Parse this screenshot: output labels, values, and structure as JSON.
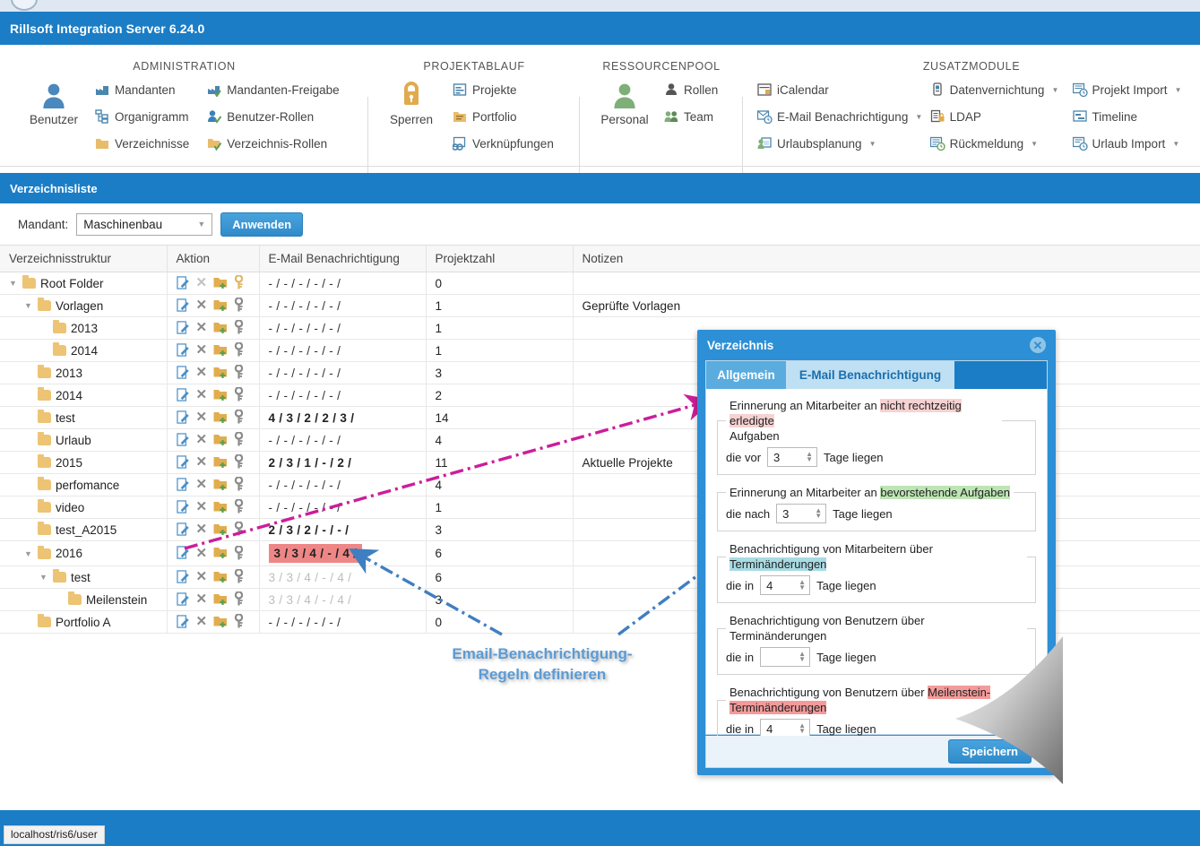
{
  "app": {
    "title": "Rillsoft Integration Server 6.24.0"
  },
  "ribbon": {
    "groups": [
      {
        "title": "ADMINISTRATION",
        "big": {
          "label": "Benutzer",
          "icon": "user-icon"
        },
        "items": [
          {
            "label": "Mandanten",
            "icon": "factory-icon",
            "caret": false
          },
          {
            "label": "Organigramm",
            "icon": "orgchart-icon",
            "caret": false
          },
          {
            "label": "Verzeichnisse",
            "icon": "folder-icon",
            "caret": false
          },
          {
            "label": "Mandanten-Freigabe",
            "icon": "factory-check-icon",
            "caret": false
          },
          {
            "label": "Benutzer-Rollen",
            "icon": "user-check-icon",
            "caret": false
          },
          {
            "label": "Verzeichnis-Rollen",
            "icon": "folder-check-icon",
            "caret": false
          }
        ]
      },
      {
        "title": "PROJEKTABLAUF",
        "big": {
          "label": "Sperren",
          "icon": "lock-icon"
        },
        "items": [
          {
            "label": "Projekte",
            "icon": "project-icon",
            "caret": false
          },
          {
            "label": "Portfolio",
            "icon": "portfolio-icon",
            "caret": false
          },
          {
            "label": "Verknüpfungen",
            "icon": "link-icon",
            "caret": false
          }
        ]
      },
      {
        "title": "RESSOURCENPOOL",
        "big": {
          "label": "Personal",
          "icon": "staff-icon"
        },
        "items": [
          {
            "label": "Rollen",
            "icon": "role-icon",
            "caret": false
          },
          {
            "label": "Team",
            "icon": "team-icon",
            "caret": false
          }
        ]
      },
      {
        "title": "ZUSATZMODULE",
        "items": [
          {
            "label": "iCalendar",
            "icon": "calendar-icon",
            "caret": false
          },
          {
            "label": "E-Mail Benachrichtigung",
            "icon": "mail-clock-icon",
            "caret": true
          },
          {
            "label": "Urlaubsplanung",
            "icon": "vacation-icon",
            "caret": true
          },
          {
            "label": "Datenvernichtung",
            "icon": "shredder-icon",
            "caret": true
          },
          {
            "label": "LDAP",
            "icon": "ldap-icon",
            "caret": false
          },
          {
            "label": "Rückmeldung",
            "icon": "feedback-icon",
            "caret": true
          },
          {
            "label": "Projekt Import",
            "icon": "project-import-icon",
            "caret": true
          },
          {
            "label": "Timeline",
            "icon": "timeline-icon",
            "caret": false
          },
          {
            "label": "Urlaub Import",
            "icon": "vacation-import-icon",
            "caret": true
          }
        ]
      }
    ]
  },
  "section": {
    "title": "Verzeichnisliste"
  },
  "filter": {
    "label": "Mandant:",
    "selected": "Maschinenbau",
    "apply_label": "Anwenden"
  },
  "table": {
    "headers": [
      "Verzeichnisstruktur",
      "Aktion",
      "E-Mail Benachrichtigung",
      "Projektzahl",
      "Notizen"
    ],
    "rows": [
      {
        "name": "Root Folder",
        "indent": 0,
        "expander": "open",
        "email": "- / - / - / - / - /",
        "style": "none",
        "projects": "0",
        "notes": "",
        "delete_dim": true,
        "key_gold": true
      },
      {
        "name": "Vorlagen",
        "indent": 1,
        "expander": "open",
        "email": "- / - / - / - / - /",
        "style": "none",
        "projects": "1",
        "notes": "Geprüfte Vorlagen",
        "delete_dim": false,
        "key_gold": false
      },
      {
        "name": "2013",
        "indent": 2,
        "expander": "none",
        "email": "- / - / - / - / - /",
        "style": "none",
        "projects": "1",
        "notes": "",
        "delete_dim": false,
        "key_gold": false
      },
      {
        "name": "2014",
        "indent": 2,
        "expander": "none",
        "email": "- / - / - / - / - /",
        "style": "none",
        "projects": "1",
        "notes": "",
        "delete_dim": false,
        "key_gold": false
      },
      {
        "name": "2013",
        "indent": 1,
        "expander": "none",
        "email": "- / - / - / - / - /",
        "style": "none",
        "projects": "3",
        "notes": "",
        "delete_dim": false,
        "key_gold": false
      },
      {
        "name": "2014",
        "indent": 1,
        "expander": "none",
        "email": "- / - / - / - / - /",
        "style": "none",
        "projects": "2",
        "notes": "",
        "delete_dim": false,
        "key_gold": false
      },
      {
        "name": "test",
        "indent": 1,
        "expander": "none",
        "email": "4 / 3 / 2 / 2 / 3 /",
        "style": "bold",
        "projects": "14",
        "notes": "",
        "delete_dim": false,
        "key_gold": false
      },
      {
        "name": "Urlaub",
        "indent": 1,
        "expander": "none",
        "email": "- / - / - / - / - /",
        "style": "none",
        "projects": "4",
        "notes": "",
        "delete_dim": false,
        "key_gold": false
      },
      {
        "name": "2015",
        "indent": 1,
        "expander": "none",
        "email": "2 / 3 / 1 / - / 2 /",
        "style": "bold",
        "projects": "11",
        "notes": "Aktuelle Projekte",
        "delete_dim": false,
        "key_gold": false
      },
      {
        "name": "perfomance",
        "indent": 1,
        "expander": "none",
        "email": "- / - / - / - / - /",
        "style": "none",
        "projects": "4",
        "notes": "",
        "delete_dim": false,
        "key_gold": false
      },
      {
        "name": "video",
        "indent": 1,
        "expander": "none",
        "email": "- / - / - / - / - /",
        "style": "none",
        "projects": "1",
        "notes": "",
        "delete_dim": false,
        "key_gold": false
      },
      {
        "name": "test_A2015",
        "indent": 1,
        "expander": "none",
        "email": "2 / 3 / 2 / - / - /",
        "style": "bold",
        "projects": "3",
        "notes": "",
        "delete_dim": false,
        "key_gold": false
      },
      {
        "name": "2016",
        "indent": 1,
        "expander": "open",
        "email": "3 / 3 / 4 / - / 4 /",
        "style": "highlight",
        "projects": "6",
        "notes": "",
        "delete_dim": false,
        "key_gold": false
      },
      {
        "name": "test",
        "indent": 2,
        "expander": "open",
        "email": "3 / 3 / 4 / - / 4 /",
        "style": "dim",
        "projects": "6",
        "notes": "",
        "delete_dim": false,
        "key_gold": false
      },
      {
        "name": "Meilenstein",
        "indent": 3,
        "expander": "none",
        "email": "3 / 3 / 4 / - / 4 /",
        "style": "dim",
        "projects": "3",
        "notes": "",
        "delete_dim": false,
        "key_gold": false
      },
      {
        "name": "Portfolio A",
        "indent": 1,
        "expander": "none",
        "email": "- / - / - / - / - /",
        "style": "none",
        "projects": "0",
        "notes": "",
        "delete_dim": false,
        "key_gold": false
      }
    ],
    "action_icons": [
      "edit-icon",
      "delete-icon",
      "add-folder-icon",
      "permissions-key-icon"
    ]
  },
  "annotation": {
    "line1": "Email-Benachrichtigung-",
    "line2": "Regeln definieren",
    "color": "#5b9bd5",
    "arrow_magenta": "#cc1d9b",
    "arrow_blue": "#3f7fc1"
  },
  "dialog": {
    "title": "Verzeichnis",
    "close_icon": "close-icon",
    "tabs": [
      {
        "label": "Allgemein",
        "active": true
      },
      {
        "label": "E-Mail Benachrichtigung",
        "active": false
      }
    ],
    "rules": [
      {
        "legend_plain": "Erinnerung an Mitarbeiter an ",
        "legend_hl": "nicht rechtzeitig erledigte",
        "legend_tail": "Aufgaben",
        "hl_color": "red",
        "prefix": "die vor",
        "value": "3",
        "suffix": "Tage liegen"
      },
      {
        "legend_plain": "Erinnerung an Mitarbeiter an ",
        "legend_hl": "bevorstehende Aufgaben",
        "legend_tail": "",
        "hl_color": "green",
        "prefix": "die nach",
        "value": "3",
        "suffix": "Tage liegen"
      },
      {
        "legend_plain": "Benachrichtigung von Mitarbeitern über ",
        "legend_hl": "Terminänderungen",
        "legend_tail": "",
        "hl_color": "cyan",
        "prefix": "die in",
        "value": "4",
        "suffix": "Tage liegen"
      },
      {
        "legend_plain": "Benachrichtigung von Benutzern über Terminänderungen",
        "legend_hl": "",
        "legend_tail": "",
        "hl_color": "none",
        "prefix": "die in",
        "value": "",
        "suffix": "Tage liegen"
      },
      {
        "legend_plain": "Benachrichtigung von Benutzern über ",
        "legend_hl": "Meilenstein-",
        "legend_tail": "Terminänderungen",
        "hl_color": "salmon",
        "prefix": "die in",
        "value": "4",
        "suffix": "Tage liegen"
      }
    ],
    "save_label": "Speichern"
  },
  "status": {
    "tooltip": "localhost/ris6/user"
  },
  "colors": {
    "brand_blue": "#1b7dc6",
    "accent_blue": "#3a97d4",
    "highlight_red": "#ef8686",
    "folder_gold": "#edc374"
  }
}
